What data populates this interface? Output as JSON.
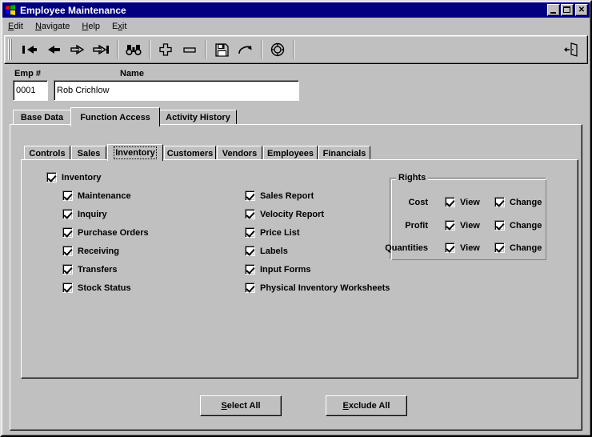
{
  "window": {
    "title": "Employee Maintenance",
    "icon": "windows-flag-icon",
    "minimize_label": "_",
    "maximize_label": "□",
    "close_label": "✕"
  },
  "menubar": {
    "items": [
      {
        "label": "Edit",
        "accel": "E"
      },
      {
        "label": "Navigate",
        "accel": "N"
      },
      {
        "label": "Help",
        "accel": "H"
      },
      {
        "label": "Exit",
        "accel": "x"
      }
    ]
  },
  "toolbar": {
    "buttons": [
      {
        "name": "first-record-icon",
        "title": "First"
      },
      {
        "name": "previous-record-icon",
        "title": "Previous"
      },
      {
        "name": "next-record-icon",
        "title": "Next"
      },
      {
        "name": "last-record-icon",
        "title": "Last"
      },
      {
        "name": "find-binoculars-icon",
        "title": "Find"
      },
      {
        "name": "add-plus-icon",
        "title": "Add"
      },
      {
        "name": "delete-minus-icon",
        "title": "Delete"
      },
      {
        "name": "save-floppy-icon",
        "title": "Save"
      },
      {
        "name": "redo-arrow-icon",
        "title": "Redo"
      },
      {
        "name": "lifebuoy-icon",
        "title": "Help"
      }
    ],
    "exit_button": {
      "name": "exit-door-icon",
      "title": "Exit"
    }
  },
  "header": {
    "emp_number_label": "Emp #",
    "emp_number_value": "0001",
    "name_label": "Name",
    "name_value": "Rob Crichlow"
  },
  "outer_tabs": {
    "items": [
      {
        "label": "Base Data",
        "active": false
      },
      {
        "label": "Function Access",
        "active": true
      },
      {
        "label": "Activity History",
        "active": false
      }
    ]
  },
  "inner_tabs": {
    "items": [
      {
        "label": "Controls",
        "active": false
      },
      {
        "label": "Sales",
        "active": false
      },
      {
        "label": "Inventory",
        "active": true
      },
      {
        "label": "Customers",
        "active": false
      },
      {
        "label": "Vendors",
        "active": false
      },
      {
        "label": "Employees",
        "active": false
      },
      {
        "label": "Financials",
        "active": false
      }
    ]
  },
  "permissions": {
    "left_column": [
      {
        "label": "Inventory",
        "checked": true,
        "indent": 0
      },
      {
        "label": "Maintenance",
        "checked": true,
        "indent": 1
      },
      {
        "label": "Inquiry",
        "checked": true,
        "indent": 1
      },
      {
        "label": "Purchase Orders",
        "checked": true,
        "indent": 1
      },
      {
        "label": "Receiving",
        "checked": true,
        "indent": 1
      },
      {
        "label": "Transfers",
        "checked": true,
        "indent": 1
      },
      {
        "label": "Stock Status",
        "checked": true,
        "indent": 1
      }
    ],
    "right_column": [
      {
        "label": "Sales Report",
        "checked": true
      },
      {
        "label": "Velocity Report",
        "checked": true
      },
      {
        "label": "Price List",
        "checked": true
      },
      {
        "label": "Labels",
        "checked": true
      },
      {
        "label": "Input Forms",
        "checked": true
      },
      {
        "label": "Physical Inventory Worksheets",
        "checked": true
      }
    ]
  },
  "rights": {
    "title": "Rights",
    "view_label": "View",
    "change_label": "Change",
    "rows": [
      {
        "label": "Cost",
        "view": true,
        "change": true
      },
      {
        "label": "Profit",
        "view": true,
        "change": true
      },
      {
        "label": "Quantities",
        "view": true,
        "change": true
      }
    ]
  },
  "footer": {
    "select_all": {
      "accel": "S",
      "rest": "elect All"
    },
    "exclude_all": {
      "accel": "E",
      "rest": "xclude All"
    }
  }
}
